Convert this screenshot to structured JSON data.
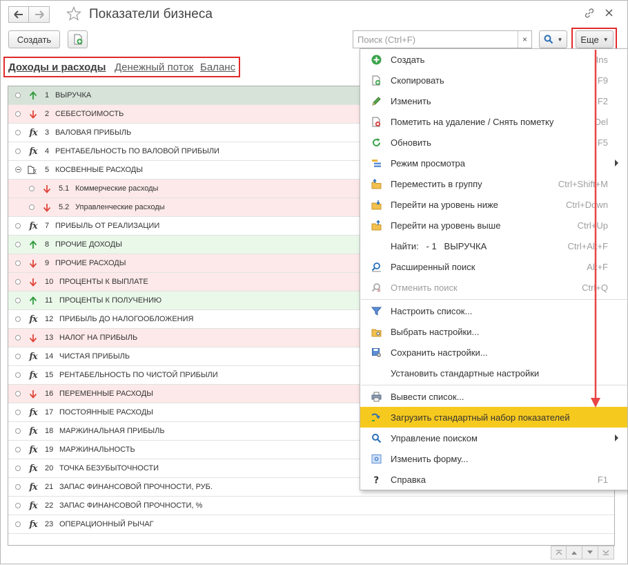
{
  "window": {
    "title": "Показатели бизнеса"
  },
  "toolbar": {
    "create_label": "Создать",
    "more_label": "Еще"
  },
  "search": {
    "placeholder": "Поиск (Ctrl+F)",
    "value": "",
    "clear_label": "×"
  },
  "tabs": [
    {
      "label": "Доходы и расходы",
      "active": true
    },
    {
      "label": "Денежный поток",
      "active": false
    },
    {
      "label": "Баланс",
      "active": false
    }
  ],
  "list": {
    "rows": [
      {
        "num": "1",
        "name": "ВЫРУЧКА",
        "icon": "arrow-up-green",
        "style": "selected",
        "level": 0
      },
      {
        "num": "2",
        "name": "СЕБЕСТОИМОСТЬ",
        "icon": "arrow-down-red",
        "style": "red",
        "level": 0
      },
      {
        "num": "3",
        "name": "ВАЛОВАЯ ПРИБЫЛЬ",
        "icon": "fx",
        "style": "plain",
        "level": 0
      },
      {
        "num": "4",
        "name": "РЕНТАБЕЛЬНОСТЬ ПО ВАЛОВОЙ ПРИБЫЛИ",
        "icon": "fx",
        "style": "plain",
        "level": 0
      },
      {
        "num": "5",
        "name": "КОСВЕННЫЕ РАСХОДЫ",
        "icon": "group-sum",
        "style": "plain",
        "level": 0,
        "expanded": true
      },
      {
        "num": "5.1",
        "name": "Коммерческие расходы",
        "icon": "arrow-down-red",
        "style": "red",
        "level": 1
      },
      {
        "num": "5.2",
        "name": "Управленческие расходы",
        "icon": "arrow-down-red",
        "style": "red",
        "level": 1
      },
      {
        "num": "7",
        "name": "ПРИБЫЛЬ ОТ РЕАЛИЗАЦИИ",
        "icon": "fx",
        "style": "plain",
        "level": 0
      },
      {
        "num": "8",
        "name": "ПРОЧИЕ ДОХОДЫ",
        "icon": "arrow-up-green",
        "style": "green",
        "level": 0
      },
      {
        "num": "9",
        "name": "ПРОЧИЕ РАСХОДЫ",
        "icon": "arrow-down-red",
        "style": "red",
        "level": 0
      },
      {
        "num": "10",
        "name": "ПРОЦЕНТЫ К ВЫПЛАТЕ",
        "icon": "arrow-down-red",
        "style": "red",
        "level": 0
      },
      {
        "num": "11",
        "name": "ПРОЦЕНТЫ К ПОЛУЧЕНИЮ",
        "icon": "arrow-up-green",
        "style": "green",
        "level": 0
      },
      {
        "num": "12",
        "name": "ПРИБЫЛЬ ДО НАЛОГООБЛОЖЕНИЯ",
        "icon": "fx",
        "style": "plain",
        "level": 0
      },
      {
        "num": "13",
        "name": "НАЛОГ НА ПРИБЫЛЬ",
        "icon": "arrow-down-red",
        "style": "red",
        "level": 0
      },
      {
        "num": "14",
        "name": "ЧИСТАЯ ПРИБЫЛЬ",
        "icon": "fx",
        "style": "plain",
        "level": 0
      },
      {
        "num": "15",
        "name": "РЕНТАБЕЛЬНОСТЬ ПО ЧИСТОЙ ПРИБЫЛИ",
        "icon": "fx",
        "style": "plain",
        "level": 0
      },
      {
        "num": "16",
        "name": "ПЕРЕМЕННЫЕ РАСХОДЫ",
        "icon": "arrow-down-red",
        "style": "red",
        "level": 0
      },
      {
        "num": "17",
        "name": "ПОСТОЯННЫЕ РАСХОДЫ",
        "icon": "fx",
        "style": "plain",
        "level": 0
      },
      {
        "num": "18",
        "name": "МАРЖИНАЛЬНАЯ ПРИБЫЛЬ",
        "icon": "fx",
        "style": "plain",
        "level": 0
      },
      {
        "num": "19",
        "name": "МАРЖИНАЛЬНОСТЬ",
        "icon": "fx",
        "style": "plain",
        "level": 0
      },
      {
        "num": "20",
        "name": "ТОЧКА БЕЗУБЫТОЧНОСТИ",
        "icon": "fx",
        "style": "plain",
        "level": 0
      },
      {
        "num": "21",
        "name": "ЗАПАС ФИНАНСОВОЙ ПРОЧНОСТИ, РУБ.",
        "icon": "fx",
        "style": "plain",
        "level": 0
      },
      {
        "num": "22",
        "name": "ЗАПАС ФИНАНСОВОЙ ПРОЧНОСТИ, %",
        "icon": "fx",
        "style": "plain",
        "level": 0
      },
      {
        "num": "23",
        "name": "ОПЕРАЦИОННЫЙ РЫЧАГ",
        "icon": "fx",
        "style": "plain",
        "level": 0
      }
    ]
  },
  "menu": {
    "groups": [
      [
        {
          "label": "Создать",
          "shortcut": "Ins",
          "icon": "plus-circle-icon"
        },
        {
          "label": "Скопировать",
          "shortcut": "F9",
          "icon": "copy-icon"
        },
        {
          "label": "Изменить",
          "shortcut": "F2",
          "icon": "pencil-icon"
        },
        {
          "label": "Пометить на удаление / Снять пометку",
          "shortcut": "Del",
          "icon": "delete-mark-icon"
        },
        {
          "label": "Обновить",
          "shortcut": "F5",
          "icon": "refresh-icon"
        },
        {
          "label": "Режим просмотра",
          "shortcut": "",
          "icon": "view-mode-icon",
          "submenu": true
        },
        {
          "label": "Переместить в группу",
          "shortcut": "Ctrl+Shift+M",
          "icon": "move-to-group-icon"
        },
        {
          "label": "Перейти на уровень ниже",
          "shortcut": "Ctrl+Down",
          "icon": "level-down-icon"
        },
        {
          "label": "Перейти на уровень выше",
          "shortcut": "Ctrl+Up",
          "icon": "level-up-icon"
        },
        {
          "label": "Найти:   - 1   ВЫРУЧКА",
          "shortcut": "Ctrl+Alt+F",
          "icon": ""
        },
        {
          "label": "Расширенный поиск",
          "shortcut": "Alt+F",
          "icon": "advanced-search-icon"
        },
        {
          "label": "Отменить поиск",
          "shortcut": "Ctrl+Q",
          "icon": "cancel-search-icon",
          "disabled": true
        }
      ],
      [
        {
          "label": "Настроить список...",
          "shortcut": "",
          "icon": "list-settings-icon"
        },
        {
          "label": "Выбрать настройки...",
          "shortcut": "",
          "icon": "choose-settings-icon"
        },
        {
          "label": "Сохранить настройки...",
          "shortcut": "",
          "icon": "save-settings-icon"
        },
        {
          "label": "Установить стандартные настройки",
          "shortcut": "",
          "icon": ""
        }
      ],
      [
        {
          "label": "Вывести список...",
          "shortcut": "",
          "icon": "print-list-icon"
        },
        {
          "label": "Загрузить стандартный набор показателей",
          "shortcut": "",
          "icon": "load-icon",
          "highlighted": true
        },
        {
          "label": "Управление поиском",
          "shortcut": "",
          "icon": "search-manage-icon",
          "submenu": true
        },
        {
          "label": "Изменить форму...",
          "shortcut": "",
          "icon": "form-icon"
        },
        {
          "label": "Справка",
          "shortcut": "F1",
          "icon": "help-icon"
        }
      ]
    ]
  },
  "colors": {
    "accent_red": "#e02a2a",
    "menu_highlight": "#f6c91f",
    "row_selected": "#d7e3d9",
    "row_red": "#fde9e9",
    "row_green": "#eaf8ea",
    "arrow_up": "#2e9a3a",
    "arrow_down": "#e0453a"
  }
}
